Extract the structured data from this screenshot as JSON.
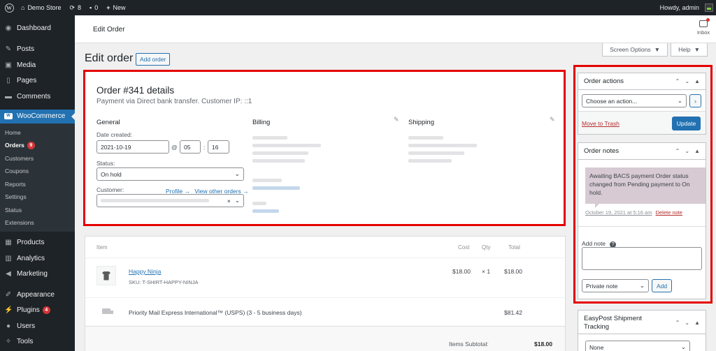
{
  "adminbar": {
    "site_name": "Demo Store",
    "updates_count": "8",
    "comments_count": "0",
    "new_label": "New",
    "howdy": "Howdy, admin"
  },
  "sidebar": {
    "items_top": [
      {
        "label": "Dashboard",
        "icon": "dashboard-icon"
      },
      {
        "label": "Posts",
        "icon": "pin-icon"
      },
      {
        "label": "Media",
        "icon": "media-icon"
      },
      {
        "label": "Pages",
        "icon": "page-icon"
      },
      {
        "label": "Comments",
        "icon": "comment-icon"
      }
    ],
    "woocommerce": "WooCommerce",
    "submenu": [
      {
        "label": "Home"
      },
      {
        "label": "Orders",
        "badge": "9"
      },
      {
        "label": "Customers"
      },
      {
        "label": "Coupons"
      },
      {
        "label": "Reports"
      },
      {
        "label": "Settings"
      },
      {
        "label": "Status"
      },
      {
        "label": "Extensions"
      }
    ],
    "items_bottom": [
      {
        "label": "Products",
        "icon": "products-icon"
      },
      {
        "label": "Analytics",
        "icon": "analytics-icon"
      },
      {
        "label": "Marketing",
        "icon": "megaphone-icon"
      },
      {
        "label": "Appearance",
        "icon": "brush-icon"
      },
      {
        "label": "Plugins",
        "icon": "plugin-icon",
        "badge": "4"
      },
      {
        "label": "Users",
        "icon": "users-icon"
      },
      {
        "label": "Tools",
        "icon": "wrench-icon"
      }
    ]
  },
  "header": {
    "title": "Edit Order",
    "inbox": "Inbox",
    "screen_options": "Screen Options",
    "help": "Help"
  },
  "page": {
    "title": "Edit order",
    "add_order": "Add order"
  },
  "order": {
    "title": "Order #341 details",
    "subtitle": "Payment via Direct bank transfer. Customer IP: ::1",
    "general": "General",
    "billing": "Billing",
    "shipping": "Shipping",
    "date_created_label": "Date created:",
    "date": "2021-10-19",
    "at": "@",
    "hour": "05",
    "colon": ":",
    "minute": "16",
    "status_label": "Status:",
    "status": "On hold",
    "customer_label": "Customer:",
    "profile_link": "Profile →",
    "other_orders_link": "View other orders →",
    "customer_clear": "×"
  },
  "items": {
    "headers": {
      "item": "Item",
      "cost": "Cost",
      "qty": "Qty",
      "total": "Total"
    },
    "product_name": "Happy Ninja",
    "sku_label": "SKU:",
    "sku": "T-SHIRT-HAPPY-NINJA",
    "cost": "$18.00",
    "qty": "× 1",
    "total": "$18.00",
    "shipping_name": "Priority Mail Express International™ (USPS) (3 - 5 business days)",
    "shipping_total": "$81.42",
    "subtotal_label": "Items Subtotal:",
    "subtotal": "$18.00"
  },
  "order_actions": {
    "title": "Order actions",
    "select": "Choose an action...",
    "go": "›",
    "trash": "Move to Trash",
    "update": "Update"
  },
  "order_notes": {
    "title": "Order notes",
    "note": "Awaiting BACS payment Order status changed from Pending payment to On hold.",
    "note_date": "October 19, 2021 at 5:16 am",
    "delete": "Delete note",
    "add_note_label": "Add note",
    "note_type": "Private note",
    "add_button": "Add"
  },
  "easypost": {
    "title": "EasyPost Shipment Tracking",
    "select": "None"
  }
}
